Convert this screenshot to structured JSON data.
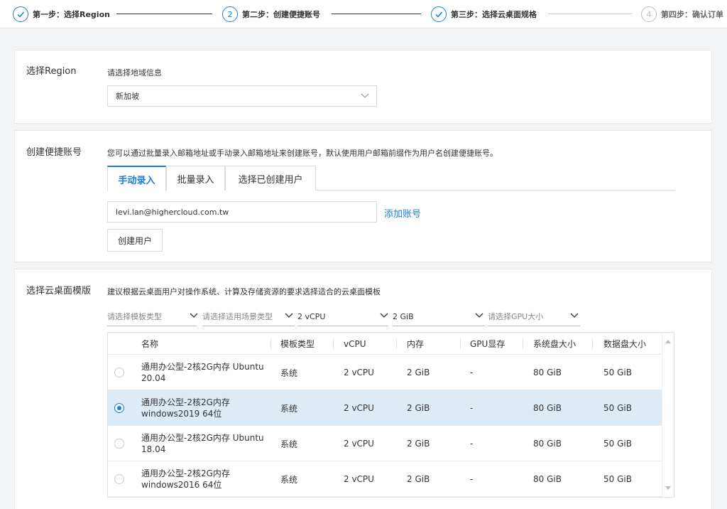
{
  "steps": [
    {
      "num": "✓",
      "label": "第一步：选择Region"
    },
    {
      "num": "2",
      "label": "第二步：创建便捷账号"
    },
    {
      "num": "✓",
      "label": "第三步：选择云桌面规格"
    },
    {
      "num": "4",
      "label": "第四步：确认订单"
    }
  ],
  "region": {
    "title": "选择Region",
    "hint": "请选择地域信息",
    "selected": "新加坡"
  },
  "account": {
    "title": "创建便捷账号",
    "description": "您可以通过批量录入邮箱地址或手动录入邮箱地址来创建账号，默认使用用户邮箱前缀作为用户名创建便捷账号。",
    "tabs": [
      "手动录入",
      "批量录入",
      "选择已创建用户"
    ],
    "email_value": "levi.lan@highercloud.com.tw",
    "add_link": "添加账号",
    "create_button": "创建用户"
  },
  "template": {
    "title": "选择云桌面模版",
    "description": "建议根据云桌面用户对操作系统、计算及存储资源的要求选择适合的云桌面模板",
    "filters": {
      "template_type": "请选择模板类型",
      "scene_type": "请选择适用场景类型",
      "vcpu": "2 vCPU",
      "memory": "2 GiB",
      "gpu": "请选择GPU大小"
    },
    "columns": [
      "名称",
      "模板类型",
      "vCPU",
      "内存",
      "GPU显存",
      "系统盘大小",
      "数据盘大小"
    ],
    "rows": [
      {
        "name": "通用办公型-2核2G内存 Ubuntu 20.04",
        "type": "系统",
        "vcpu": "2 vCPU",
        "mem": "2 GiB",
        "gpu": "-",
        "sys": "80 GiB",
        "data": "50 GiB"
      },
      {
        "name": "通用办公型-2核2G内存 windows2019 64位",
        "type": "系统",
        "vcpu": "2 vCPU",
        "mem": "2 GiB",
        "gpu": "-",
        "sys": "80 GiB",
        "data": "50 GiB"
      },
      {
        "name": "通用办公型-2核2G内存 Ubuntu 18.04",
        "type": "系统",
        "vcpu": "2 vCPU",
        "mem": "2 GiB",
        "gpu": "-",
        "sys": "80 GiB",
        "data": "50 GiB"
      },
      {
        "name": "通用办公型-2核2G内存 windows2016 64位",
        "type": "系统",
        "vcpu": "2 vCPU",
        "mem": "2 GiB",
        "gpu": "-",
        "sys": "80 GiB",
        "data": "50 GiB"
      }
    ],
    "selected_row": 1
  },
  "colors": {
    "accent": "#1a7dd6",
    "selected_row": "#ddebf7"
  }
}
